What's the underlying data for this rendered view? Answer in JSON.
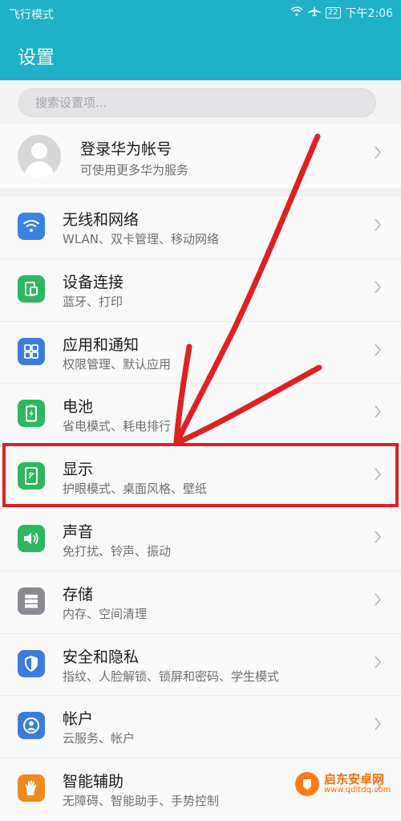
{
  "status": {
    "mode": "飞行模式",
    "battery": "22",
    "time": "下午2:06"
  },
  "header": {
    "title": "设置"
  },
  "search": {
    "placeholder": "搜索设置项..."
  },
  "account": {
    "name": "登录华为帐号",
    "subtitle": "可使用更多华为服务"
  },
  "items": [
    {
      "title": "无线和网络",
      "subtitle": "WLAN、双卡管理、移动网络",
      "icon": "wifi-icon",
      "color": "#3b82e0"
    },
    {
      "title": "设备连接",
      "subtitle": "蓝牙、打印",
      "icon": "device-connect-icon",
      "color": "#2fb760"
    },
    {
      "title": "应用和通知",
      "subtitle": "权限管理、默认应用",
      "icon": "apps-icon",
      "color": "#3b7be0"
    },
    {
      "title": "电池",
      "subtitle": "省电模式、耗电排行",
      "icon": "battery-icon",
      "color": "#2fb760"
    },
    {
      "title": "显示",
      "subtitle": "护眼模式、桌面风格、壁纸",
      "icon": "display-icon",
      "color": "#2fb760"
    },
    {
      "title": "声音",
      "subtitle": "免打扰、铃声、振动",
      "icon": "speaker-icon",
      "color": "#2fb760"
    },
    {
      "title": "存储",
      "subtitle": "内存、空间清理",
      "icon": "storage-icon",
      "color": "#8a8a92"
    },
    {
      "title": "安全和隐私",
      "subtitle": "指纹、人脸解锁、锁屏和密码、学生模式",
      "icon": "shield-icon",
      "color": "#3b7be0"
    },
    {
      "title": "帐户",
      "subtitle": "云服务、帐户",
      "icon": "account-icon",
      "color": "#3b7be0"
    },
    {
      "title": "智能辅助",
      "subtitle": "无障碍、智能助手、手势控制",
      "icon": "hand-icon",
      "color": "#f08a1e"
    }
  ],
  "annotation": {
    "color": "#df2121"
  },
  "watermark": {
    "title": "启东安卓网",
    "url": "www.qdltdq.com"
  }
}
